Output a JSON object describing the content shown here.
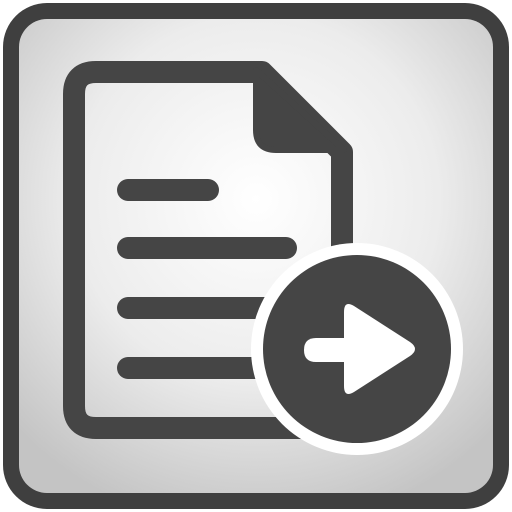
{
  "icon": {
    "name": "export-document",
    "shapes": [
      "document",
      "text-lines",
      "arrow-circle"
    ]
  },
  "colors": {
    "frame": "#3f3f3f",
    "glyph": "#454545",
    "tile_center": "#ffffff",
    "tile_edge": "#c4c4c4",
    "arrow_fill": "#ffffff"
  }
}
